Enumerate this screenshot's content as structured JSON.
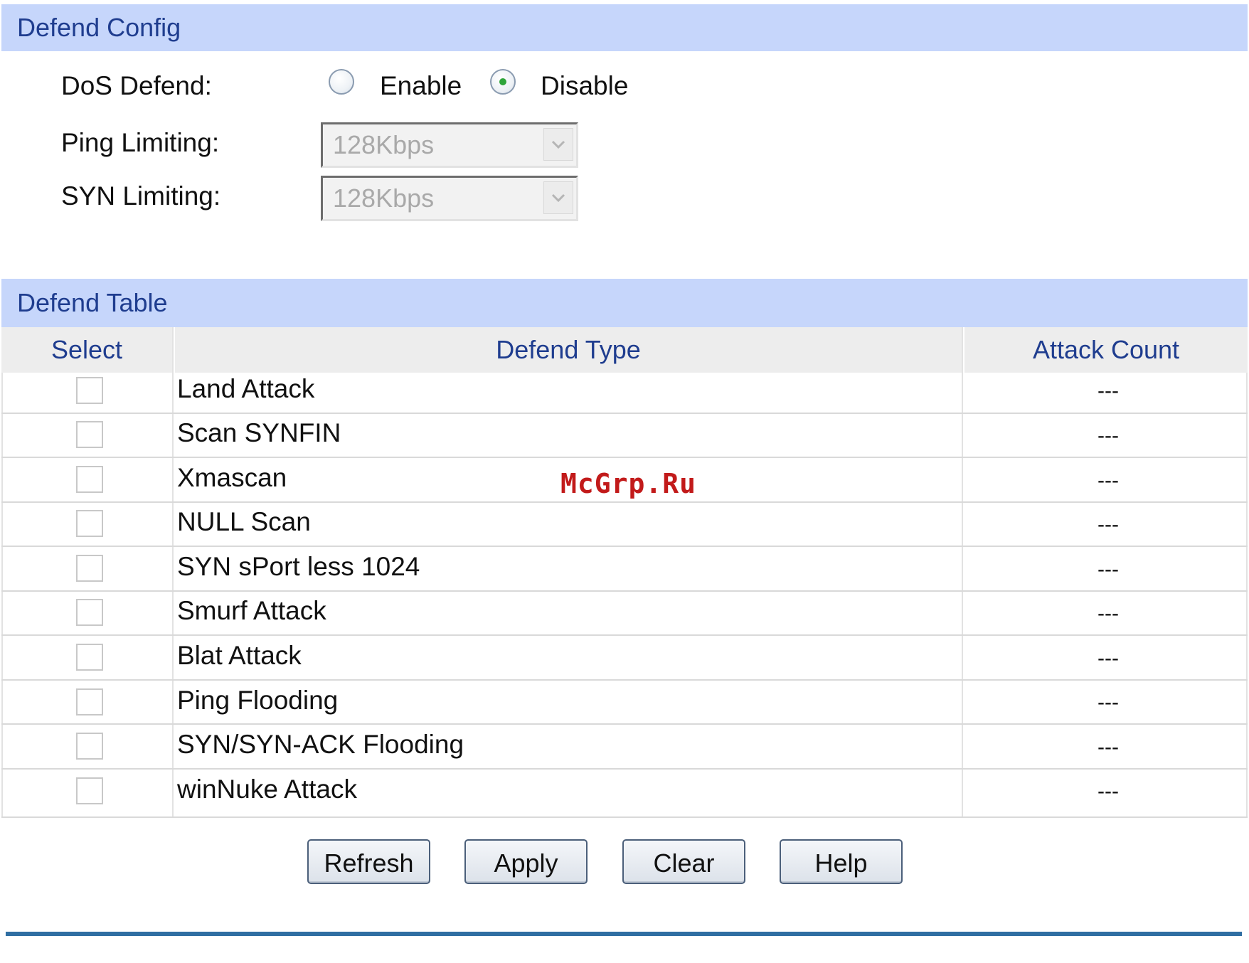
{
  "defend_config": {
    "header": "Defend Config",
    "dos_defend_label": "DoS Defend:",
    "dos_options": [
      {
        "label": "Enable",
        "selected": false
      },
      {
        "label": "Disable",
        "selected": true
      }
    ],
    "ping_limiting_label": "Ping Limiting:",
    "ping_limiting_value": "128Kbps",
    "syn_limiting_label": "SYN Limiting:",
    "syn_limiting_value": "128Kbps"
  },
  "defend_table": {
    "header": "Defend Table",
    "columns": [
      "Select",
      "Defend Type",
      "Attack Count"
    ],
    "rows": [
      {
        "type": "Land Attack",
        "count": "---"
      },
      {
        "type": "Scan SYNFIN",
        "count": "---"
      },
      {
        "type": "Xmascan",
        "count": "---"
      },
      {
        "type": "NULL Scan",
        "count": "---"
      },
      {
        "type": "SYN sPort less 1024",
        "count": "---"
      },
      {
        "type": "Smurf Attack",
        "count": "---"
      },
      {
        "type": "Blat Attack",
        "count": "---"
      },
      {
        "type": "Ping Flooding",
        "count": "---"
      },
      {
        "type": "SYN/SYN-ACK Flooding",
        "count": "---"
      },
      {
        "type": "winNuke Attack",
        "count": "---"
      }
    ]
  },
  "buttons": {
    "refresh": "Refresh",
    "apply": "Apply",
    "clear": "Clear",
    "help": "Help"
  },
  "watermark": "McGrp.Ru",
  "colors": {
    "section_header_bg": "#c6d6fb",
    "header_text": "#1f3d8f",
    "bottom_rule": "#2f6ea2",
    "watermark": "#c21a1a"
  }
}
